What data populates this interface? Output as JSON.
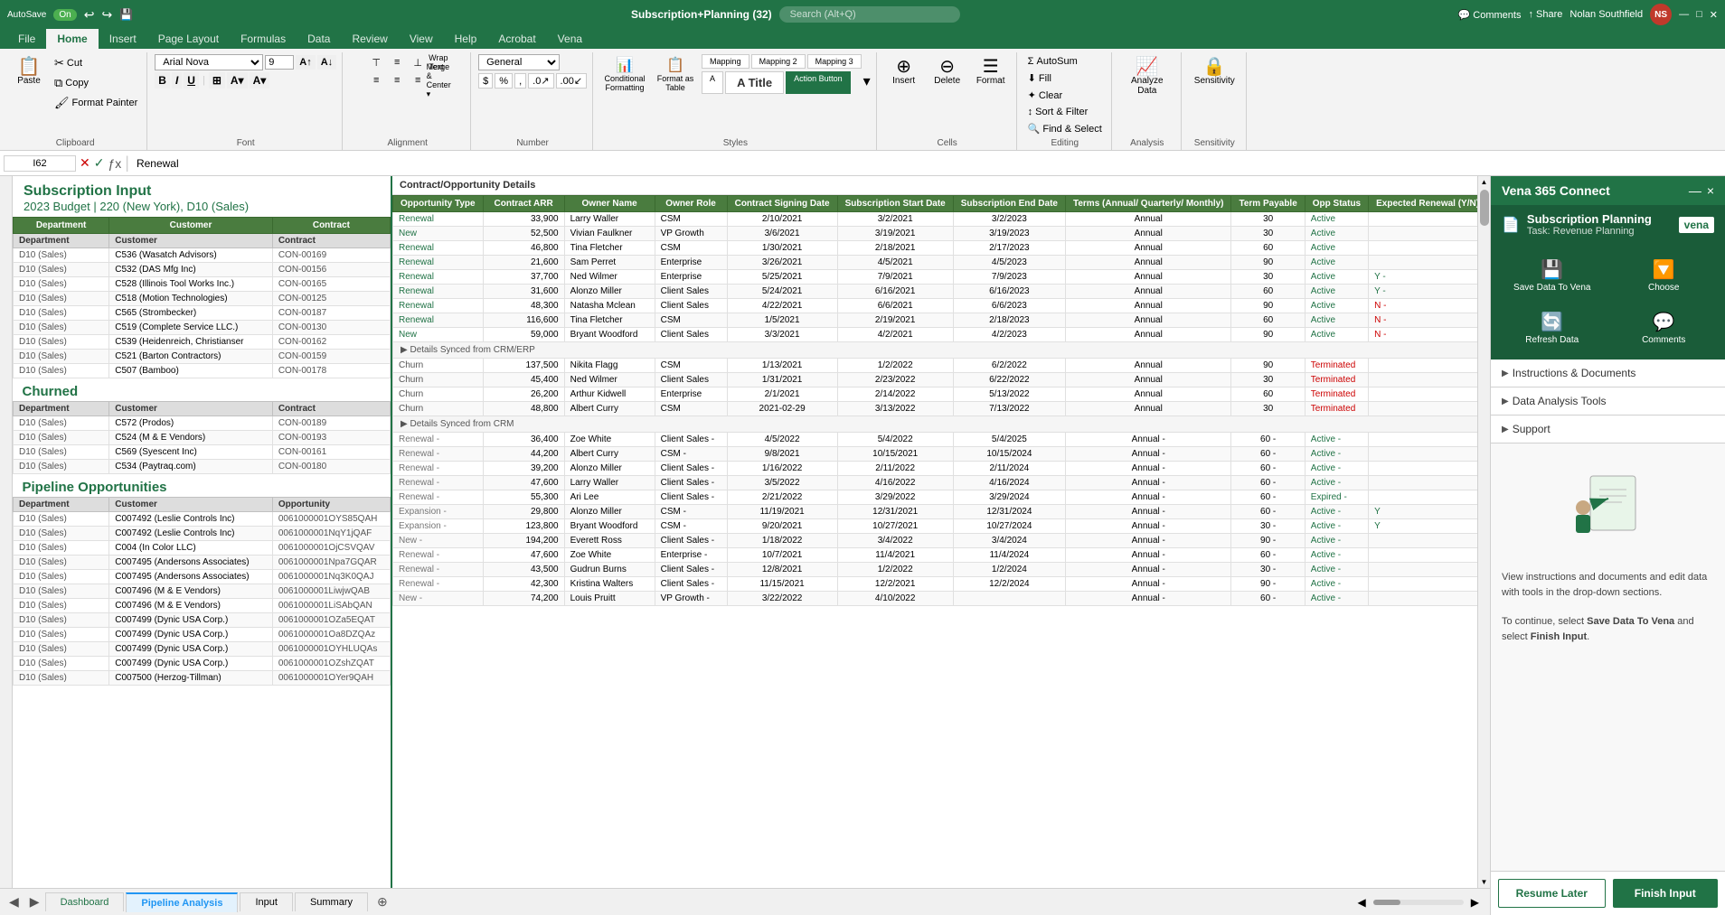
{
  "titleBar": {
    "autosave": "AutoSave",
    "autosave_on": "On",
    "fileName": "Subscription+Planning (32)",
    "search_placeholder": "Search (Alt+Q)",
    "userName": "Nolan Southfield",
    "userInitials": "NS"
  },
  "ribbonTabs": [
    "File",
    "Home",
    "Insert",
    "Page Layout",
    "Formulas",
    "Data",
    "Review",
    "View",
    "Help",
    "Acrobat",
    "Vena"
  ],
  "activeTab": "Home",
  "clipboard": {
    "paste": "Paste",
    "cut": "Cut",
    "copy": "Copy",
    "format_painter": "Format Painter",
    "label": "Clipboard"
  },
  "font": {
    "name": "Arial Nova",
    "size": "9",
    "label": "Font"
  },
  "alignment": {
    "label": "Alignment"
  },
  "number": {
    "format": "General",
    "label": "Number"
  },
  "styles": {
    "conditional_formatting": "Conditional Formatting",
    "format_as_table": "Format as Table",
    "mapping": "Mapping",
    "mapping2": "Mapping 2",
    "mapping3": "Mapping 3",
    "a_title": "A Title",
    "action_button": "Action Button",
    "label": "Styles"
  },
  "cells": {
    "insert": "Insert",
    "delete": "Delete",
    "format": "Format",
    "label": "Cells"
  },
  "editing": {
    "autosum": "AutoSum",
    "fill": "Fill",
    "clear": "Clear",
    "sort_filter": "Sort & Filter",
    "find_select": "Find & Select",
    "label": "Editing"
  },
  "analysis": {
    "analyze": "Analyze Data",
    "label": "Analysis"
  },
  "sensitivity": {
    "label": "Sensitivity"
  },
  "formulaBar": {
    "cellRef": "I62",
    "value": "Renewal"
  },
  "spreadsheet": {
    "title": "Subscription Input",
    "subtitle": "2023 Budget | 220 (New York), D10 (Sales)"
  },
  "contractDetails": {
    "header": "Contract/Opportunity Details",
    "detailsSyncedCRM": "Details Synced from CRM/ERP",
    "detailsSyncedCRM2": "Details Synced from CRM",
    "columns": [
      "Opportunity Type",
      "Contract ARR",
      "Owner Name",
      "Owner Role",
      "Contract Signing Date",
      "Subscription Start Date",
      "Subscription End Date",
      "Terms (Annual/ Quarterly/ Monthly)",
      "Term Payable",
      "Opp Status",
      "Expected Renewal (Y/N)"
    ]
  },
  "renewalRows": [
    {
      "dept": "D10 (Sales)",
      "customer": "C536 (Wasatch Advisors)",
      "contract": "CON-00169",
      "type": "Renewal",
      "arr": "33,900",
      "owner": "Larry Waller",
      "role": "CSM",
      "signing": "2/10/2021",
      "start": "3/2/2021",
      "end": "3/2/2023",
      "terms": "Annual",
      "payable": "30",
      "status": "Active",
      "renewal": ""
    },
    {
      "dept": "D10 (Sales)",
      "customer": "C532 (DAS Mfg Inc)",
      "contract": "CON-00156",
      "type": "New",
      "arr": "52,500",
      "owner": "Vivian Faulkner",
      "role": "VP Growth",
      "signing": "3/6/2021",
      "start": "3/19/2021",
      "end": "3/19/2023",
      "terms": "Annual",
      "payable": "30",
      "status": "Active",
      "renewal": ""
    },
    {
      "dept": "D10 (Sales)",
      "customer": "C528 (Illinois Tool Works Inc.)",
      "contract": "CON-00165",
      "type": "Renewal",
      "arr": "46,800",
      "owner": "Tina Fletcher",
      "role": "CSM",
      "signing": "1/30/2021",
      "start": "2/18/2021",
      "end": "2/17/2023",
      "terms": "Annual",
      "payable": "60",
      "status": "Active",
      "renewal": ""
    },
    {
      "dept": "D10 (Sales)",
      "customer": "C518 (Motion Technologies)",
      "contract": "CON-00125",
      "type": "Renewal",
      "arr": "21,600",
      "owner": "Sam Perret",
      "role": "Enterprise",
      "signing": "3/26/2021",
      "start": "4/5/2021",
      "end": "4/5/2023",
      "terms": "Annual",
      "payable": "90",
      "status": "Active",
      "renewal": ""
    },
    {
      "dept": "D10 (Sales)",
      "customer": "C565 (Strombecker)",
      "contract": "CON-00187",
      "type": "Renewal",
      "arr": "37,700",
      "owner": "Ned Wilmer",
      "role": "Enterprise",
      "signing": "5/25/2021",
      "start": "7/9/2021",
      "end": "7/9/2023",
      "terms": "Annual",
      "payable": "30",
      "status": "Active",
      "renewal": "Y -"
    },
    {
      "dept": "D10 (Sales)",
      "customer": "C519 (Complete Service LLC.)",
      "contract": "CON-00130",
      "type": "Renewal",
      "arr": "31,600",
      "owner": "Alonzo Miller",
      "role": "Client Sales",
      "signing": "5/24/2021",
      "start": "6/16/2021",
      "end": "6/16/2023",
      "terms": "Annual",
      "payable": "60",
      "status": "Active",
      "renewal": "Y -"
    },
    {
      "dept": "D10 (Sales)",
      "customer": "C539 (Heidenreich, Christianser",
      "contract": "CON-00162",
      "type": "Renewal",
      "arr": "48,300",
      "owner": "Natasha Mclean",
      "role": "Client Sales",
      "signing": "4/22/2021",
      "start": "6/6/2021",
      "end": "6/6/2023",
      "terms": "Annual",
      "payable": "90",
      "status": "Active",
      "renewal": "N -"
    },
    {
      "dept": "D10 (Sales)",
      "customer": "C521 (Barton Contractors)",
      "contract": "CON-00159",
      "type": "Renewal",
      "arr": "116,600",
      "owner": "Tina Fletcher",
      "role": "CSM",
      "signing": "1/5/2021",
      "start": "2/19/2021",
      "end": "2/18/2023",
      "terms": "Annual",
      "payable": "60",
      "status": "Active",
      "renewal": "N -"
    },
    {
      "dept": "D10 (Sales)",
      "customer": "C507 (Bamboo)",
      "contract": "CON-00178",
      "type": "New",
      "arr": "59,000",
      "owner": "Bryant Woodford",
      "role": "Client Sales",
      "signing": "3/3/2021",
      "start": "4/2/2021",
      "end": "4/2/2023",
      "terms": "Annual",
      "payable": "90",
      "status": "Active",
      "renewal": "N -"
    }
  ],
  "churnedSection": {
    "title": "Churned",
    "columns": [
      "Department",
      "Customer",
      "Contract"
    ]
  },
  "churnedRows": [
    {
      "dept": "D10 (Sales)",
      "customer": "C572 (Prodos)",
      "contract": "CON-00189",
      "type": "Churn",
      "arr": "137,500",
      "owner": "Nikita Flagg",
      "role": "CSM",
      "signing": "1/13/2021",
      "start": "1/2/2022",
      "end": "6/2/2022",
      "terms": "Annual",
      "payable": "90",
      "status": "Terminated",
      "renewal": ""
    },
    {
      "dept": "D10 (Sales)",
      "customer": "C524 (M & E Vendors)",
      "contract": "CON-00193",
      "type": "Churn",
      "arr": "45,400",
      "owner": "Ned Wilmer",
      "role": "Client Sales",
      "signing": "1/31/2021",
      "start": "2/23/2022",
      "end": "6/22/2022",
      "terms": "Annual",
      "payable": "30",
      "status": "Terminated",
      "renewal": ""
    },
    {
      "dept": "D10 (Sales)",
      "customer": "C569 (Syescent Inc)",
      "contract": "CON-00161",
      "type": "Churn",
      "arr": "26,200",
      "owner": "Arthur Kidwell",
      "role": "Enterprise",
      "signing": "2/1/2021",
      "start": "2/14/2022",
      "end": "5/13/2022",
      "terms": "Annual",
      "payable": "60",
      "status": "Terminated",
      "renewal": ""
    },
    {
      "dept": "D10 (Sales)",
      "customer": "C534 (Paytraq.com)",
      "contract": "CON-00180",
      "type": "Churn",
      "arr": "48,800",
      "owner": "Albert Curry",
      "role": "CSM",
      "signing": "2021-02-29",
      "start": "3/13/2022",
      "end": "7/13/2022",
      "terms": "Annual",
      "payable": "30",
      "status": "Terminated",
      "renewal": ""
    }
  ],
  "pipelineSection": {
    "title": "Pipeline Opportunities",
    "columns": [
      "Department",
      "Customer",
      "Opportunity"
    ]
  },
  "pipelineRows": [
    {
      "dept": "D10 (Sales)",
      "customer": "C007492 (Leslie Controls Inc)",
      "opp": "0061000001OYS85QAH",
      "type": "Renewal -",
      "arr": "36,400",
      "owner": "Zoe White",
      "role": "Client Sales -",
      "signing": "4/5/2022",
      "start": "5/4/2022",
      "end": "5/4/2025",
      "terms": "Annual -",
      "payable": "60 -",
      "status": "Active -",
      "renewal": ""
    },
    {
      "dept": "D10 (Sales)",
      "customer": "C007492 (Leslie Controls Inc)",
      "opp": "0061000001NqY1jQAF",
      "type": "Renewal -",
      "arr": "44,200",
      "owner": "Albert Curry",
      "role": "CSM -",
      "signing": "9/8/2021",
      "start": "10/15/2021",
      "end": "10/15/2024",
      "terms": "Annual -",
      "payable": "60 -",
      "status": "Active -",
      "renewal": ""
    },
    {
      "dept": "D10 (Sales)",
      "customer": "C004 (In Color LLC)",
      "opp": "0061000001OjCSVQAV",
      "type": "Renewal -",
      "arr": "39,200",
      "owner": "Alonzo Miller",
      "role": "Client Sales -",
      "signing": "1/16/2022",
      "start": "2/11/2022",
      "end": "2/11/2024",
      "terms": "Annual -",
      "payable": "60 -",
      "status": "Active -",
      "renewal": ""
    },
    {
      "dept": "D10 (Sales)",
      "customer": "C007495 (Andersons Associates)",
      "opp": "0061000001Npa7GQAR",
      "type": "Renewal -",
      "arr": "47,600",
      "owner": "Larry Waller",
      "role": "Client Sales -",
      "signing": "3/5/2022",
      "start": "4/16/2022",
      "end": "4/16/2024",
      "terms": "Annual -",
      "payable": "60 -",
      "status": "Active -",
      "renewal": ""
    },
    {
      "dept": "D10 (Sales)",
      "customer": "C007495 (Andersons Associates)",
      "opp": "0061000001Nq3K0QAJ",
      "type": "Renewal -",
      "arr": "55,300",
      "owner": "Ari Lee",
      "role": "Client Sales -",
      "signing": "2/21/2022",
      "start": "3/29/2022",
      "end": "3/29/2024",
      "terms": "Annual -",
      "payable": "60 -",
      "status": "Expired -",
      "renewal": ""
    },
    {
      "dept": "D10 (Sales)",
      "customer": "C007496 (M & E Vendors)",
      "opp": "0061000001LiwjwQAB",
      "type": "Expansion -",
      "arr": "29,800",
      "owner": "Alonzo Miller",
      "role": "CSM -",
      "signing": "11/19/2021",
      "start": "12/31/2021",
      "end": "12/31/2024",
      "terms": "Annual -",
      "payable": "60 -",
      "status": "Active -",
      "renewal": "Y"
    },
    {
      "dept": "D10 (Sales)",
      "customer": "C007496 (M & E Vendors)",
      "opp": "0061000001LiSAbQAN",
      "type": "Expansion -",
      "arr": "123,800",
      "owner": "Bryant Woodford",
      "role": "CSM -",
      "signing": "9/20/2021",
      "start": "10/27/2021",
      "end": "10/27/2024",
      "terms": "Annual -",
      "payable": "30 -",
      "status": "Active -",
      "renewal": "Y"
    },
    {
      "dept": "D10 (Sales)",
      "customer": "C007499 (Dynic USA Corp.)",
      "opp": "0061000001OZa5EQAT",
      "type": "New -",
      "arr": "194,200",
      "owner": "Everett Ross",
      "role": "Client Sales -",
      "signing": "1/18/2022",
      "start": "3/4/2022",
      "end": "3/4/2024",
      "terms": "Annual -",
      "payable": "90 -",
      "status": "Active -",
      "renewal": ""
    },
    {
      "dept": "D10 (Sales)",
      "customer": "C007499 (Dynic USA Corp.)",
      "opp": "0061000001Oa8DZQAz",
      "type": "Renewal -",
      "arr": "47,600",
      "owner": "Zoe White",
      "role": "Enterprise -",
      "signing": "10/7/2021",
      "start": "11/4/2021",
      "end": "11/4/2024",
      "terms": "Annual -",
      "payable": "60 -",
      "status": "Active -",
      "renewal": ""
    },
    {
      "dept": "D10 (Sales)",
      "customer": "C007499 (Dynic USA Corp.)",
      "opp": "0061000001OYHLUQAs",
      "type": "Renewal -",
      "arr": "43,500",
      "owner": "Gudrun Burns",
      "role": "Client Sales -",
      "signing": "12/8/2021",
      "start": "1/2/2022",
      "end": "1/2/2024",
      "terms": "Annual -",
      "payable": "30 -",
      "status": "Active -",
      "renewal": ""
    },
    {
      "dept": "D10 (Sales)",
      "customer": "C007499 (Dynic USA Corp.)",
      "opp": "0061000001OZshZQAT",
      "type": "Renewal -",
      "arr": "42,300",
      "owner": "Kristina Walters",
      "role": "Client Sales -",
      "signing": "11/15/2021",
      "start": "12/2/2021",
      "end": "12/2/2024",
      "terms": "Annual -",
      "payable": "90 -",
      "status": "Active -",
      "renewal": ""
    },
    {
      "dept": "D10 (Sales)",
      "customer": "C007500 (Herzog-Tillman)",
      "opp": "0061000001OYer9QAH",
      "type": "New -",
      "arr": "74,200",
      "owner": "Louis Pruitt",
      "role": "VP Growth -",
      "signing": "3/22/2022",
      "start": "4/10/2022",
      "end": "",
      "terms": "Annual -",
      "payable": "60 -",
      "status": "Active -",
      "renewal": ""
    }
  ],
  "vena": {
    "title": "Vena 365 Connect",
    "close_btn": "×",
    "planning_title": "Subscription Planning",
    "task_label": "Task: Revenue Planning",
    "logo": "vena",
    "actions": [
      {
        "label": "Save Data To Vena",
        "icon": "💾"
      },
      {
        "label": "Choose",
        "icon": "🔽"
      },
      {
        "label": "Refresh Data",
        "icon": "🔄"
      },
      {
        "label": "Comments",
        "icon": "💬"
      }
    ],
    "sections": [
      {
        "label": "Instructions & Documents",
        "expanded": false
      },
      {
        "label": "Data Analysis Tools",
        "expanded": false
      },
      {
        "label": "Support",
        "expanded": false
      }
    ],
    "illustration_text": "📋",
    "body_text_1": "View instructions and documents and edit data with tools in the drop-down sections.",
    "body_text_2": "To continue, select Save Data To Vena and select Finish Input.",
    "save_data_bold": "Save Data To Vena",
    "finish_bold": "Finish Input",
    "footer": {
      "resume": "Resume Later",
      "finish": "Finish Input"
    }
  },
  "sheetTabs": [
    {
      "label": "Dashboard",
      "active": false,
      "color": "green"
    },
    {
      "label": "Pipeline Analysis",
      "active": true,
      "color": "blue"
    },
    {
      "label": "Input",
      "active": false,
      "color": ""
    },
    {
      "label": "Summary",
      "active": false,
      "color": ""
    }
  ],
  "statusBar": {
    "scrollbar_left": "◀",
    "scrollbar_right": "▶"
  }
}
